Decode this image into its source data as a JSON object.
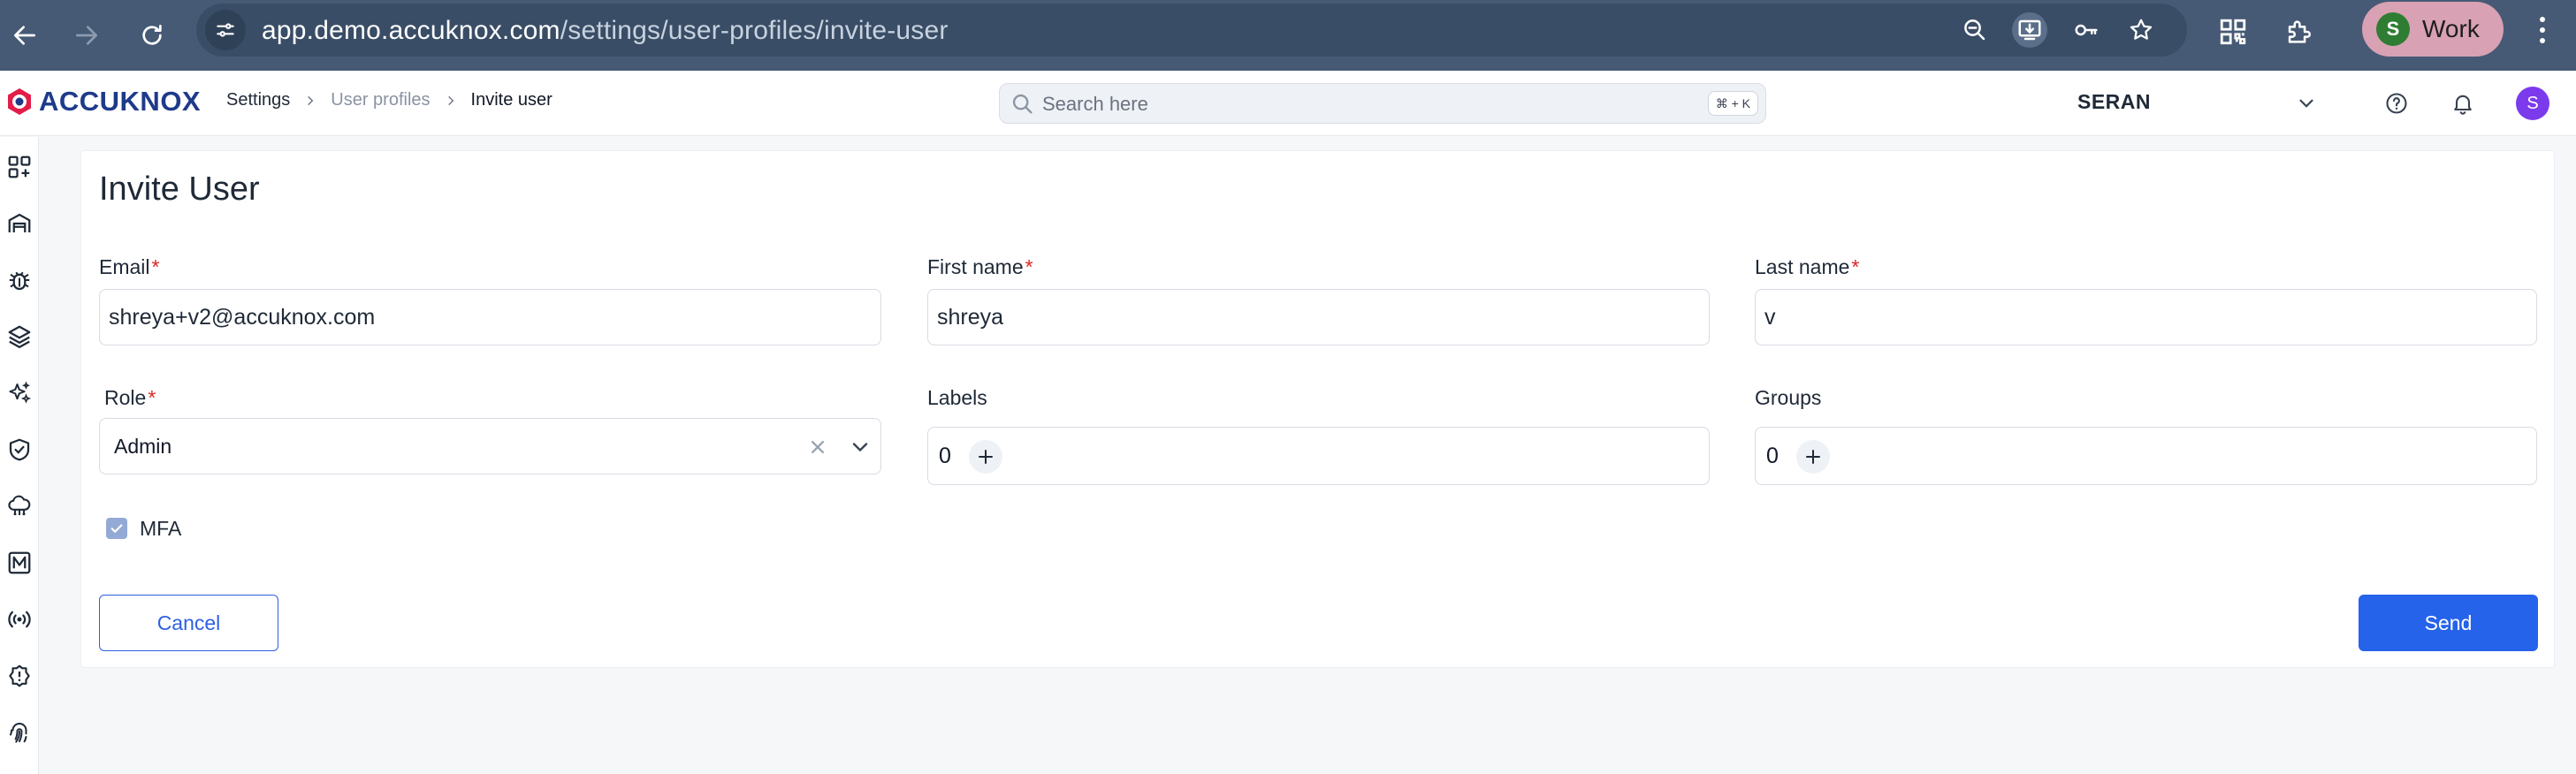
{
  "browser": {
    "url_host": "app.demo.accuknox.com",
    "url_path": "/settings/user-profiles/invite-user",
    "profile_initial": "S",
    "profile_label": "Work"
  },
  "app": {
    "logo_text": "ACCUKNOX",
    "breadcrumb": {
      "settings": "Settings",
      "user_profiles": "User profiles",
      "current": "Invite user"
    },
    "search": {
      "placeholder": "Search here",
      "shortcut": "⌘ + K"
    },
    "tenant": "SERAN",
    "user_initial": "S"
  },
  "form": {
    "title": "Invite User",
    "email": {
      "label": "Email",
      "value": "shreya+v2@accuknox.com"
    },
    "first_name": {
      "label": "First name",
      "value": "shreya"
    },
    "last_name": {
      "label": "Last name",
      "value": "v"
    },
    "role": {
      "label": "Role",
      "value": "Admin"
    },
    "labels": {
      "label": "Labels",
      "count": "0"
    },
    "groups": {
      "label": "Groups",
      "count": "0"
    },
    "mfa": {
      "label": "MFA",
      "checked": true
    },
    "required_mark": "*",
    "cancel_label": "Cancel",
    "send_label": "Send"
  },
  "colors": {
    "chrome": "#465a75",
    "primary": "#2563eb",
    "required": "#dc2626"
  }
}
